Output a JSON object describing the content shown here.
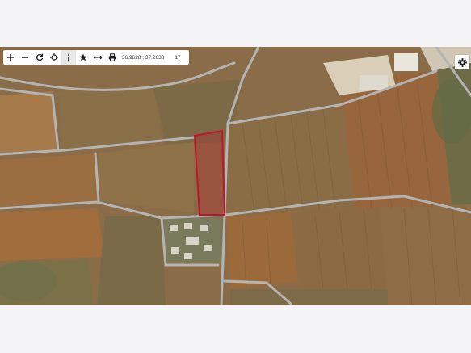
{
  "toolbar": {
    "buttons": [
      {
        "name": "zoom-in",
        "icon": "plus-icon"
      },
      {
        "name": "zoom-out",
        "icon": "minus-icon"
      },
      {
        "name": "refresh",
        "icon": "refresh-icon"
      },
      {
        "name": "locate",
        "icon": "crosshair-icon"
      },
      {
        "name": "info",
        "icon": "info-icon"
      },
      {
        "name": "favorite",
        "icon": "star-icon"
      },
      {
        "name": "measure",
        "icon": "measure-icon"
      },
      {
        "name": "print",
        "icon": "print-icon"
      }
    ],
    "coordinates": "36.9628 : 37.2638",
    "zoom": "17"
  },
  "settings": {
    "icon": "gear-icon"
  },
  "map": {
    "type": "satellite",
    "highlight_color": "#c0142b",
    "road_color": "#b4b4b4"
  }
}
